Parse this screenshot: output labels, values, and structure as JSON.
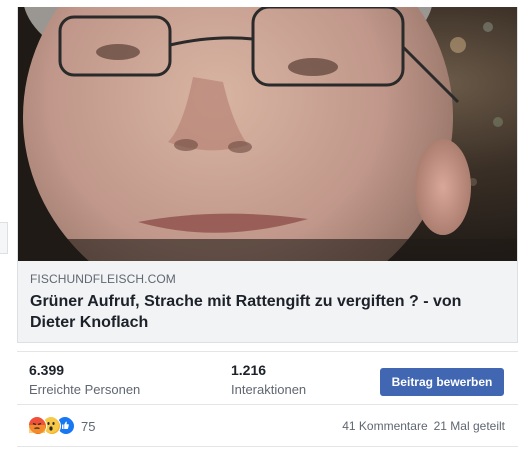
{
  "post": {
    "link_domain": "FISCHUNDFLEISCH.COM",
    "link_title": "Grüner Aufruf, Strache mit Rattengift zu vergiften ? - von Dieter Knoflach",
    "image_subject": "close-up photo of a man with glasses"
  },
  "insights": {
    "reach_value": "6.399",
    "reach_label": "Erreichte Personen",
    "engagement_value": "1.216",
    "engagement_label": "Interaktionen",
    "promote_label": "Beitrag bewerben",
    "promote_color": "#4267b2"
  },
  "reactions": {
    "icons": [
      "angry-reaction-icon",
      "wow-reaction-icon",
      "like-reaction-icon"
    ],
    "count": "75",
    "comments": "41 Kommentare",
    "shares": "21 Mal geteilt"
  }
}
